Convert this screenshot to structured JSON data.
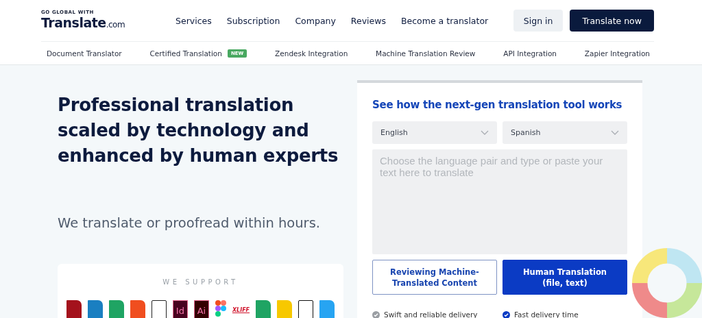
{
  "logo": {
    "tagline": "GO GLOBAL WITH",
    "name": "Translate",
    "suffix": ".com"
  },
  "nav": [
    "Services",
    "Subscription",
    "Company",
    "Reviews",
    "Become a translator"
  ],
  "actions": [
    {
      "label": "Sign in",
      "kind": "secondary"
    },
    {
      "label": "Translate now",
      "kind": "primary"
    }
  ],
  "subnav": [
    {
      "label": "Document Translator"
    },
    {
      "label": "Certified Translation",
      "badge": "NEW"
    },
    {
      "label": "Zendesk Integration"
    },
    {
      "label": "Machine Translation Review"
    },
    {
      "label": "API Integration"
    },
    {
      "label": "Zapier Integration"
    }
  ],
  "hero": {
    "headline": "Professional translation scaled by technology and enhanced by human experts",
    "subtitle": "We translate or proofread within hours."
  },
  "support": {
    "title": "WE SUPPORT",
    "formats": [
      {
        "kind": "file",
        "color": "#a4121c"
      },
      {
        "kind": "file",
        "color": "#1a7fc1"
      },
      {
        "kind": "file",
        "color": "#1fa463"
      },
      {
        "kind": "file",
        "color": "#f04e1f"
      },
      {
        "kind": "outline",
        "color": "#222222"
      },
      {
        "label": "Id",
        "kind": "app",
        "color": "#49021f"
      },
      {
        "label": "Ai",
        "kind": "app",
        "color": "#330000"
      },
      {
        "kind": "figma"
      },
      {
        "label": "XLIFF",
        "kind": "word",
        "color": "#d0142c"
      },
      {
        "kind": "file",
        "color": "#1fa463"
      },
      {
        "kind": "file",
        "color": "#f7c800"
      },
      {
        "kind": "outline",
        "color": "#111111"
      },
      {
        "kind": "file",
        "color": "#27a4f2"
      }
    ]
  },
  "tool": {
    "heading": "See how the next-gen translation tool works",
    "source_language": "English",
    "target_language": "Spanish",
    "placeholder": "Choose the language pair and type or paste your text here to translate",
    "options": [
      {
        "label": "Reviewing Machine-Translated Content",
        "selected": false,
        "feature": "Swift and reliable delivery"
      },
      {
        "label": "Human Translation (file, text)",
        "selected": true,
        "feature": "Fast delivery time"
      }
    ]
  }
}
